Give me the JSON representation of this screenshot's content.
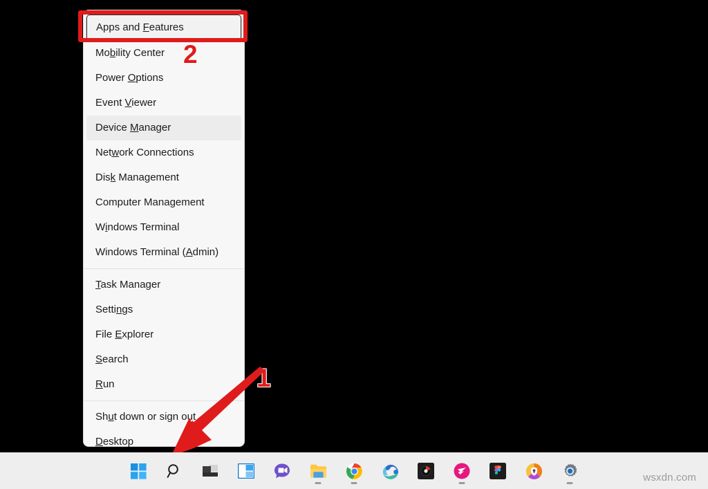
{
  "window": {
    "title": "Windows 11 Desktop with Win+X Power User Menu",
    "background_color": "#000000"
  },
  "context_menu": {
    "name": "Win+X Power User Menu",
    "background_color": "#f7f7f7",
    "sections": [
      {
        "items": [
          {
            "label": "Apps and Features",
            "before": "Apps and ",
            "accel": "F",
            "after": "eatures",
            "state": "focused"
          },
          {
            "label": "Mobility Center",
            "before": "Mo",
            "accel": "b",
            "after": "ility Center",
            "state": "normal"
          },
          {
            "label": "Power Options",
            "before": "Power ",
            "accel": "O",
            "after": "ptions",
            "state": "normal"
          },
          {
            "label": "Event Viewer",
            "before": "Event ",
            "accel": "V",
            "after": "iewer",
            "state": "normal"
          },
          {
            "label": "Device Manager",
            "before": "Device ",
            "accel": "M",
            "after": "anager",
            "state": "hovered"
          },
          {
            "label": "Network Connections",
            "before": "Net",
            "accel": "w",
            "after": "ork Connections",
            "state": "normal"
          },
          {
            "label": "Disk Management",
            "before": "Dis",
            "accel": "k",
            "after": " Management",
            "state": "normal"
          },
          {
            "label": "Computer Management",
            "before": "Computer Mana",
            "accel": "g",
            "after": "ement",
            "state": "normal"
          },
          {
            "label": "Windows Terminal",
            "before": "W",
            "accel": "i",
            "after": "ndows Terminal",
            "state": "normal"
          },
          {
            "label": "Windows Terminal (Admin)",
            "before": "Windows Terminal (",
            "accel": "A",
            "after": "dmin)",
            "state": "normal"
          }
        ]
      },
      {
        "items": [
          {
            "label": "Task Manager",
            "before": "",
            "accel": "T",
            "after": "ask Manager",
            "state": "normal"
          },
          {
            "label": "Settings",
            "before": "Setti",
            "accel": "n",
            "after": "gs",
            "state": "normal"
          },
          {
            "label": "File Explorer",
            "before": "File ",
            "accel": "E",
            "after": "xplorer",
            "state": "normal"
          },
          {
            "label": "Search",
            "before": "",
            "accel": "S",
            "after": "earch",
            "state": "normal"
          },
          {
            "label": "Run",
            "before": "",
            "accel": "R",
            "after": "un",
            "state": "normal"
          }
        ]
      },
      {
        "items": [
          {
            "label": "Shut down or sign out",
            "before": "Sh",
            "accel": "u",
            "after": "t down or sign out",
            "state": "normal"
          },
          {
            "label": "Desktop",
            "before": "",
            "accel": "D",
            "after": "esktop",
            "state": "normal"
          }
        ]
      }
    ]
  },
  "annotations": {
    "highlight_color": "#e01b1b",
    "box_target": "Apps and Features",
    "markers": [
      {
        "number": "1",
        "points_to": "start-button"
      },
      {
        "number": "2",
        "points_to": "apps-and-features-menu-item"
      }
    ]
  },
  "taskbar": {
    "background_color": "#eeeeee",
    "items": [
      {
        "name": "start-button",
        "label": "Start",
        "icon": "windows-logo-icon",
        "running": false
      },
      {
        "name": "search-button",
        "label": "Search",
        "icon": "search-icon",
        "running": false
      },
      {
        "name": "task-view-button",
        "label": "Task View",
        "icon": "task-view-icon",
        "running": false
      },
      {
        "name": "widgets-button",
        "label": "Widgets",
        "icon": "widgets-icon",
        "running": false
      },
      {
        "name": "chat-button",
        "label": "Chat",
        "icon": "chat-icon",
        "running": false
      },
      {
        "name": "file-explorer-button",
        "label": "File Explorer",
        "icon": "folder-icon",
        "running": true
      },
      {
        "name": "chrome-button",
        "label": "Google Chrome",
        "icon": "chrome-icon",
        "running": true
      },
      {
        "name": "edge-button",
        "label": "Microsoft Edge",
        "icon": "edge-icon",
        "running": false
      },
      {
        "name": "dark-app-button",
        "label": "App",
        "icon": "dark-app-icon",
        "running": false
      },
      {
        "name": "pink-app-button",
        "label": "App",
        "icon": "pink-app-icon",
        "running": true
      },
      {
        "name": "figma-button",
        "label": "Figma",
        "icon": "figma-icon",
        "running": false
      },
      {
        "name": "avast-browser-button",
        "label": "Avast Secure Browser",
        "icon": "avast-browser-icon",
        "running": false
      },
      {
        "name": "settings-button",
        "label": "Settings",
        "icon": "gear-icon",
        "running": true
      }
    ]
  },
  "watermark": {
    "text": "wsxdn.com"
  }
}
